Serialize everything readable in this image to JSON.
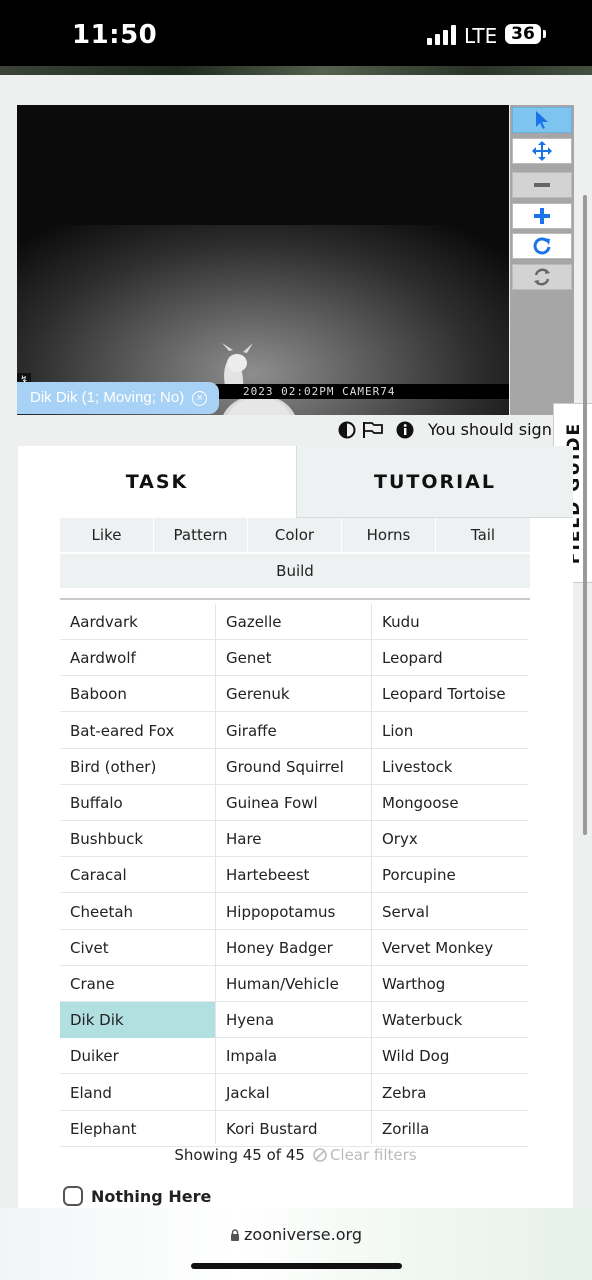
{
  "status_bar": {
    "time": "11:50",
    "network": "LTE",
    "battery": "36"
  },
  "subject": {
    "camera_footer": "2023   02:02PM   CAMER74",
    "annotation_tag": "Dik Dik (1; Moving; No)",
    "tag_remove": "×"
  },
  "toolbar": {
    "tools": [
      {
        "name": "pointer",
        "icon": "cursor-icon",
        "state": "active"
      },
      {
        "name": "pan",
        "icon": "move-arrows-icon",
        "state": "normal"
      },
      {
        "name": "zoom-out",
        "icon": "minus-icon",
        "state": "disabled"
      },
      {
        "name": "zoom-in",
        "icon": "plus-icon",
        "state": "normal"
      },
      {
        "name": "rotate",
        "icon": "rotate-icon",
        "state": "normal"
      },
      {
        "name": "reset",
        "icon": "refresh-icon",
        "state": "disabled"
      }
    ]
  },
  "meta": {
    "sign_in_text": "You should sign"
  },
  "side": {
    "field_guide_label": "FIELD GUIDE"
  },
  "tabs": {
    "task": "TASK",
    "tutorial": "TUTORIAL"
  },
  "filters": [
    "Like",
    "Pattern",
    "Color",
    "Horns",
    "Tail",
    "Build"
  ],
  "species_columns": [
    [
      "Aardvark",
      "Aardwolf",
      "Baboon",
      "Bat-eared Fox",
      "Bird (other)",
      "Buffalo",
      "Bushbuck",
      "Caracal",
      "Cheetah",
      "Civet",
      "Crane",
      "Dik Dik",
      "Duiker",
      "Eland",
      "Elephant"
    ],
    [
      "Gazelle",
      "Genet",
      "Gerenuk",
      "Giraffe",
      "Ground Squirrel",
      "Guinea Fowl",
      "Hare",
      "Hartebeest",
      "Hippopotamus",
      "Honey Badger",
      "Human/Vehicle",
      "Hyena",
      "Impala",
      "Jackal",
      "Kori Bustard"
    ],
    [
      "Kudu",
      "Leopard",
      "Leopard Tortoise",
      "Lion",
      "Livestock",
      "Mongoose",
      "Oryx",
      "Porcupine",
      "Serval",
      "Vervet Monkey",
      "Warthog",
      "Waterbuck",
      "Wild Dog",
      "Zebra",
      "Zorilla"
    ]
  ],
  "selected_species": "Dik Dik",
  "showing": {
    "text": "Showing 45 of 45",
    "clear": "Clear filters"
  },
  "nothing_here": "Nothing Here",
  "url_bar": {
    "domain": "zooniverse.org"
  },
  "colors": {
    "accent": "#7dc4f0",
    "tag": "#a8d2f5",
    "selected": "#b2e0e0",
    "icon_blue": "#1a73e8"
  }
}
